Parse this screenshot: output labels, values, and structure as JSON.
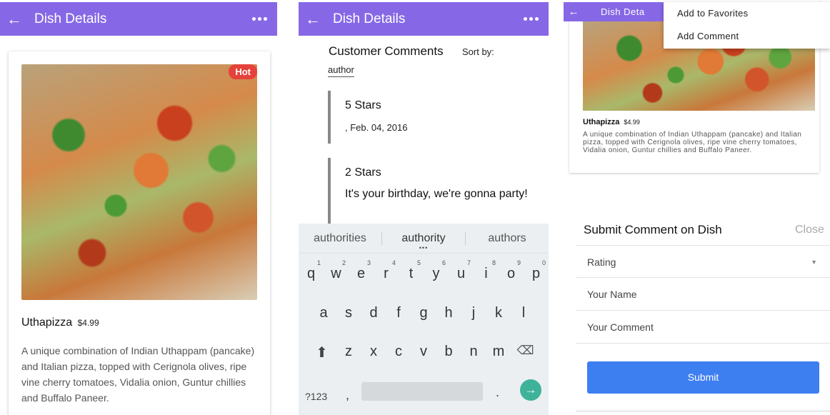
{
  "screen1": {
    "appbar": {
      "back_icon": "arrow-left-icon",
      "title": "Dish Details",
      "more_icon": "more-dots-icon"
    },
    "dish": {
      "badge": "Hot",
      "name": "Uthapizza",
      "price": "$4.99",
      "description": "A unique combination of Indian Uthappam (pancake) and Italian pizza, topped with Cerignola olives, ripe vine cherry tomatoes, Vidalia onion, Guntur chillies and Buffalo Paneer."
    }
  },
  "screen2": {
    "appbar": {
      "title": "Dish Details"
    },
    "comments_title": "Customer Comments",
    "sort_label": "Sort by:",
    "sort_value": "author",
    "comments": [
      {
        "stars": "5 Stars",
        "meta": ", Feb. 04, 2016"
      },
      {
        "stars": "2 Stars",
        "text": "It's your birthday, we're gonna party!"
      }
    ],
    "keyboard": {
      "suggestions": [
        "authorities",
        "authority",
        "authors"
      ],
      "row1": [
        "q",
        "w",
        "e",
        "r",
        "t",
        "y",
        "u",
        "i",
        "o",
        "p"
      ],
      "row1_nums": [
        "1",
        "2",
        "3",
        "4",
        "5",
        "6",
        "7",
        "8",
        "9",
        "0"
      ],
      "row2": [
        "a",
        "s",
        "d",
        "f",
        "g",
        "h",
        "j",
        "k",
        "l"
      ],
      "row3": [
        "z",
        "x",
        "c",
        "v",
        "b",
        "n",
        "m"
      ],
      "symbols_key": "?123",
      "comma_key": ",",
      "period_key": "."
    }
  },
  "screen3": {
    "appbar": {
      "title": "Dish Deta"
    },
    "menu": [
      "Add to Favorites",
      "Add Comment"
    ],
    "dish": {
      "name": "Uthapizza",
      "price": "$4.99",
      "description": "A unique combination of Indian Uthappam (pancake) and Italian pizza, topped with Cerignola olives, ripe vine cherry tomatoes, Vidalia onion, Guntur chillies and Buffalo Paneer."
    },
    "form": {
      "title": "Submit Comment on Dish",
      "close": "Close",
      "rating_placeholder": "Rating",
      "name_placeholder": "Your Name",
      "comment_placeholder": "Your Comment",
      "submit": "Submit"
    }
  },
  "colors": {
    "appbar": "#8668e6",
    "hot_badge": "#e5423b",
    "submit": "#3d7ef1",
    "keyboard_enter": "#3fb29a"
  }
}
